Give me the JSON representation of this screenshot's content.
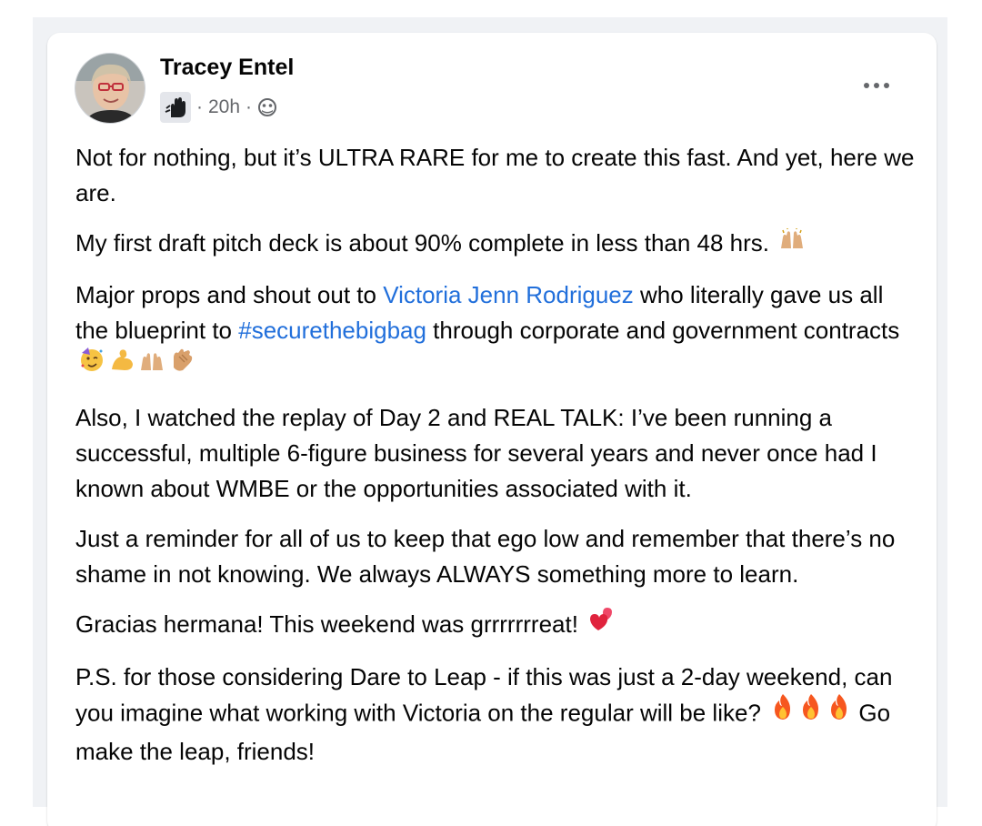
{
  "post": {
    "author_name": "Tracey Entel",
    "avatar_icon": "profile-photo-avatar",
    "badge_icon": "raised-hand-badge-icon",
    "separator": "·",
    "time_ago": "20h",
    "audience_icon": "group-audience-icon",
    "more_icon": "more-options-icon",
    "paragraphs": {
      "p1": "Not for nothing, but it’s ULTRA RARE for me to create this fast. And yet, here we are.",
      "p2": "My first draft pitch deck is about 90% complete in less than 48 hrs.",
      "p3_before": "Major props and shout out to ",
      "p3_mention": "Victoria Jenn Rodriguez",
      "p3_middle": " who literally gave us all the blueprint to ",
      "p3_hashtag": "#securethebigbag",
      "p3_after": " through corporate and government contracts",
      "p4": "Also, I watched the replay of Day 2 and REAL TALK: I’ve been running a successful, multiple 6-figure business for several years and never once had I known about WMBE or the opportunities associated with it.",
      "p5": "Just a reminder for all of us to keep that ego low and remember that there’s no shame in not knowing. We always ALWAYS something more to learn.",
      "p6": "Gracias hermana! This weekend was grrrrrrreat!",
      "p7_before": "P.S. for those considering Dare to Leap - if this was just a 2-day weekend, can you imagine what working with Victoria on the regular will be like?",
      "p7_after": " Go make the leap, friends!"
    },
    "emoji_icons": [
      "raising-hands-icon",
      "party-face-icon",
      "flexed-biceps-icon",
      "raising-hands-icon",
      "clapping-hands-icon",
      "two-hearts-icon",
      "fire-icon"
    ],
    "colors": {
      "link": "#216fdb",
      "meta_text": "#65676b",
      "feed_background": "#f0f2f5"
    }
  }
}
